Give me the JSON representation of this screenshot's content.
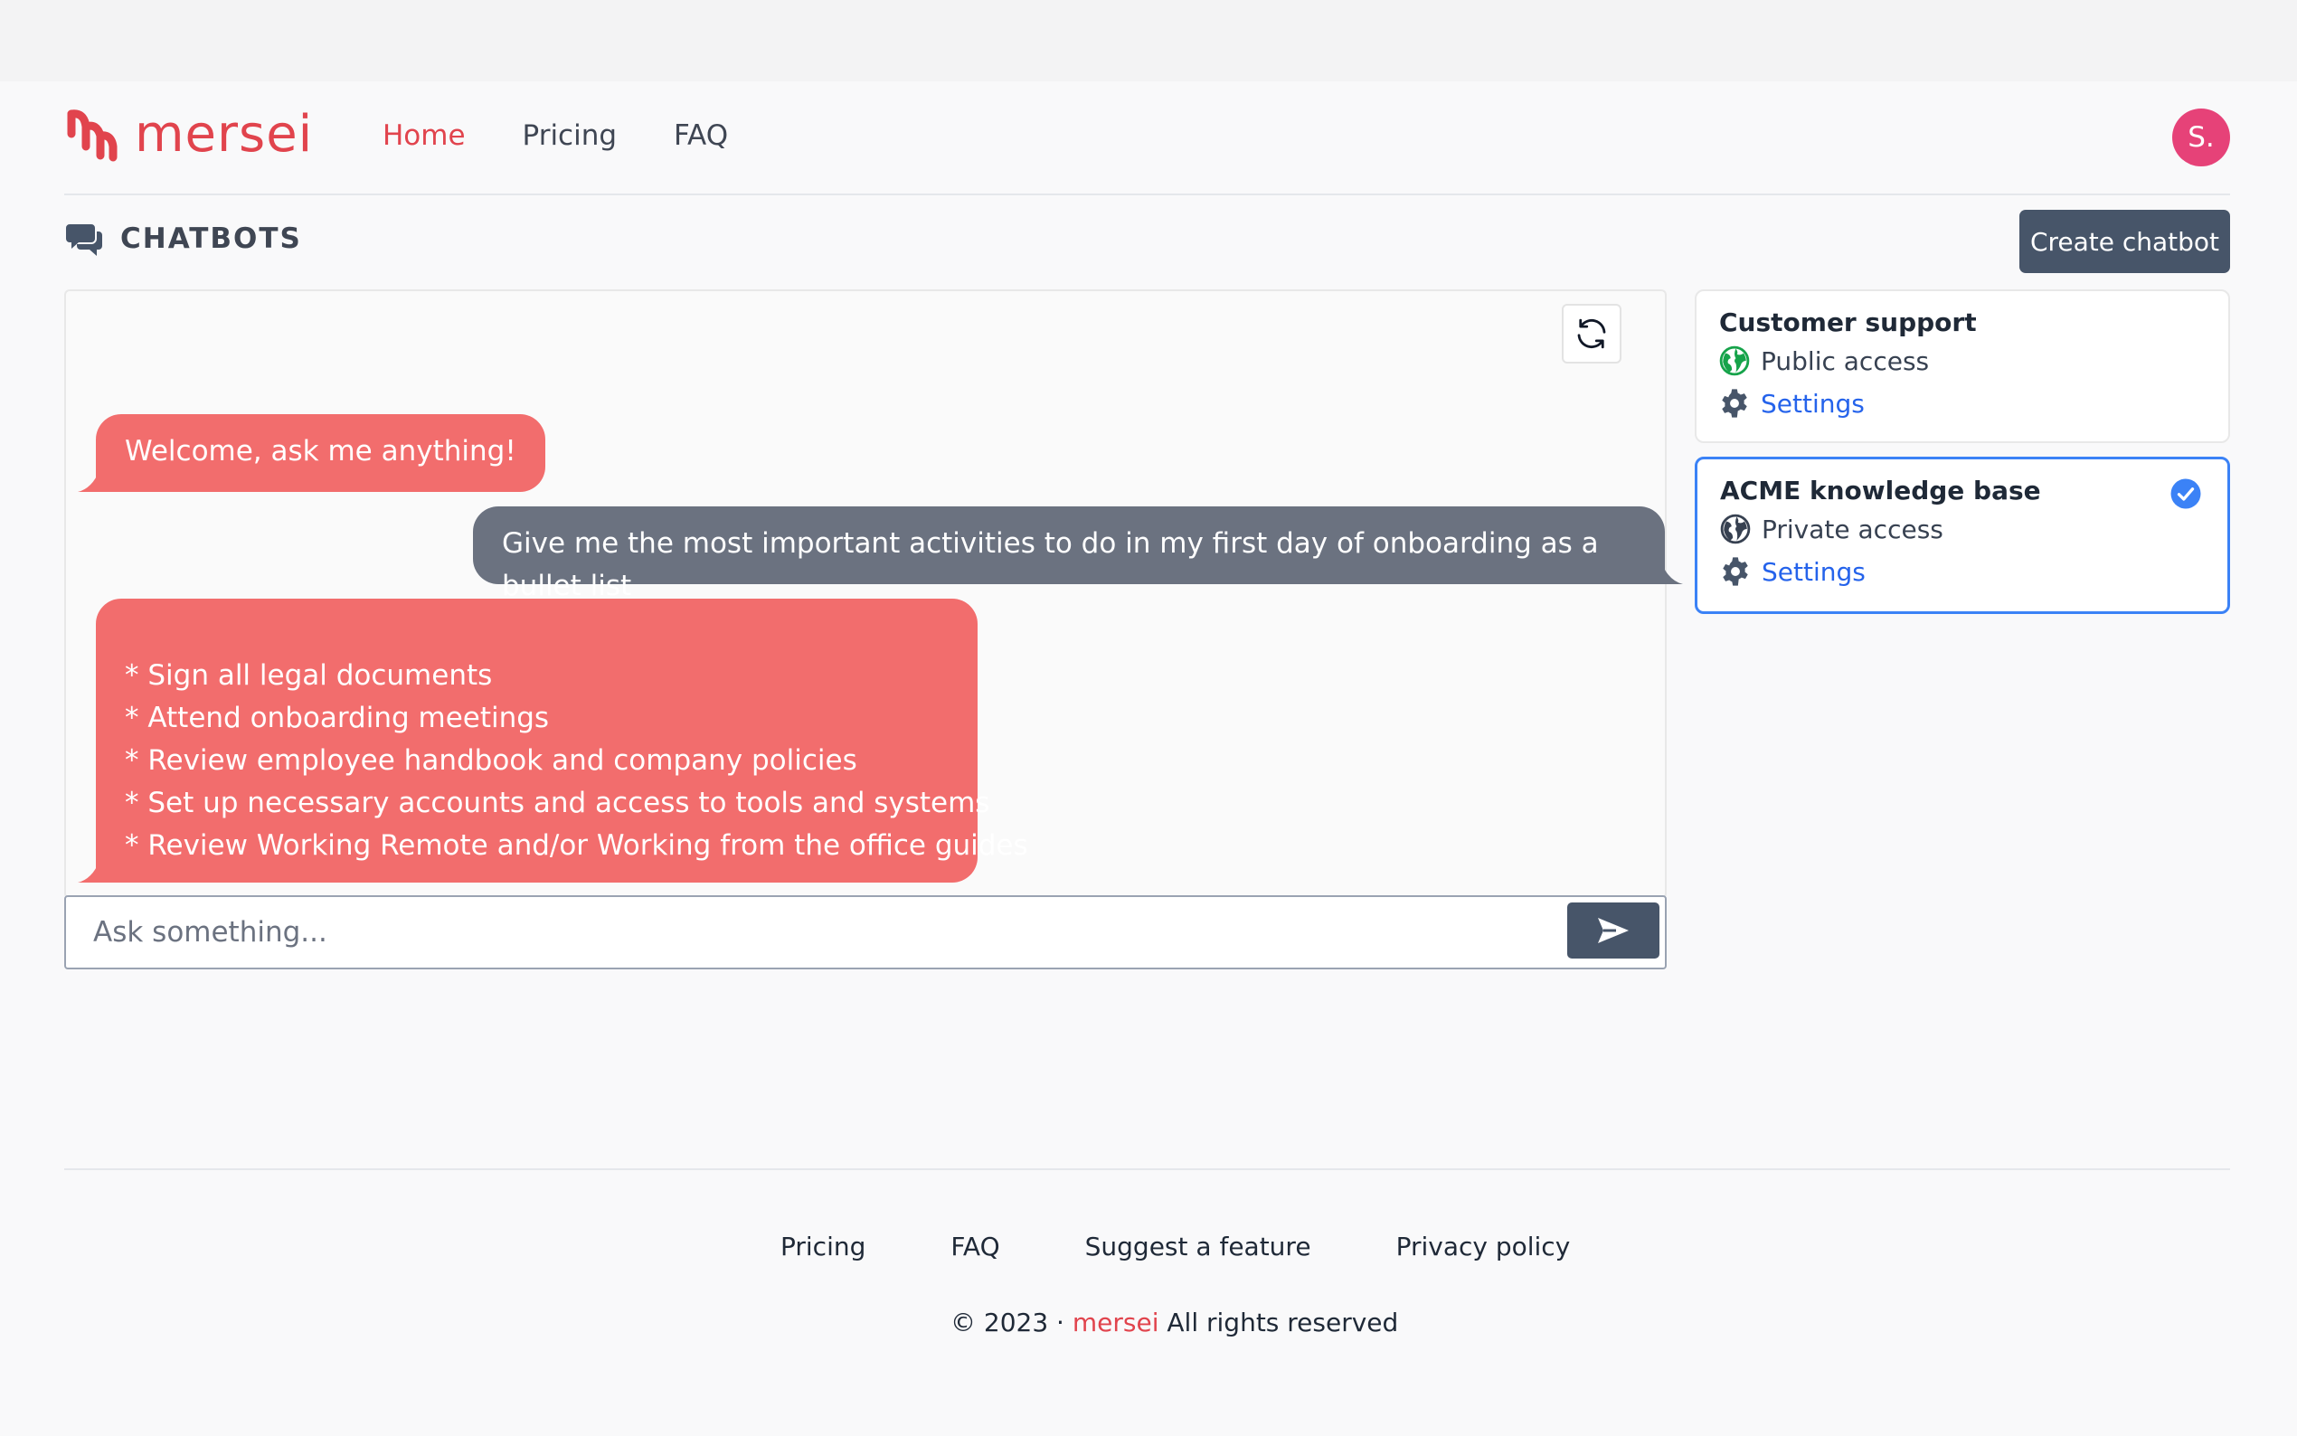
{
  "nav": {
    "logo_text": "mersei",
    "links": [
      {
        "label": "Home",
        "active": true
      },
      {
        "label": "Pricing",
        "active": false
      },
      {
        "label": "FAQ",
        "active": false
      }
    ],
    "avatar_initial": "S."
  },
  "header": {
    "title": "CHATBOTS",
    "icon": "chat-bubbles-icon",
    "create_button": "Create chatbot"
  },
  "chat": {
    "messages": [
      {
        "role": "bot",
        "text": "Welcome, ask me anything!"
      },
      {
        "role": "user",
        "text": "Give me the most important activities to do in my first day of onboarding as a bullet list"
      },
      {
        "role": "bot",
        "items": [
          "* Sign all legal documents",
          "* Attend onboarding meetings",
          "* Review employee handbook and company policies",
          "* Set up necessary accounts and access to tools and systems",
          "* Review Working Remote and/or Working from the office guides"
        ]
      }
    ],
    "input_placeholder": "Ask something...",
    "input_value": ""
  },
  "chatbots": [
    {
      "name": "Customer support",
      "access": "Public access",
      "settings_label": "Settings",
      "selected": false
    },
    {
      "name": "ACME knowledge base",
      "access": "Private access",
      "settings_label": "Settings",
      "selected": true
    }
  ],
  "footer": {
    "links": [
      "Pricing",
      "FAQ",
      "Suggest a feature",
      "Privacy policy"
    ],
    "copyright_prefix": "© 2023 ·",
    "copyright_brand": "mersei",
    "copyright_suffix": "All rights reserved"
  },
  "colors": {
    "brand": "#e1444d",
    "bot_bubble": "#f26d6d",
    "user_bubble": "#6b7280",
    "button_dark": "#475569",
    "selected_border": "#3b82f6",
    "avatar": "#e64278"
  }
}
